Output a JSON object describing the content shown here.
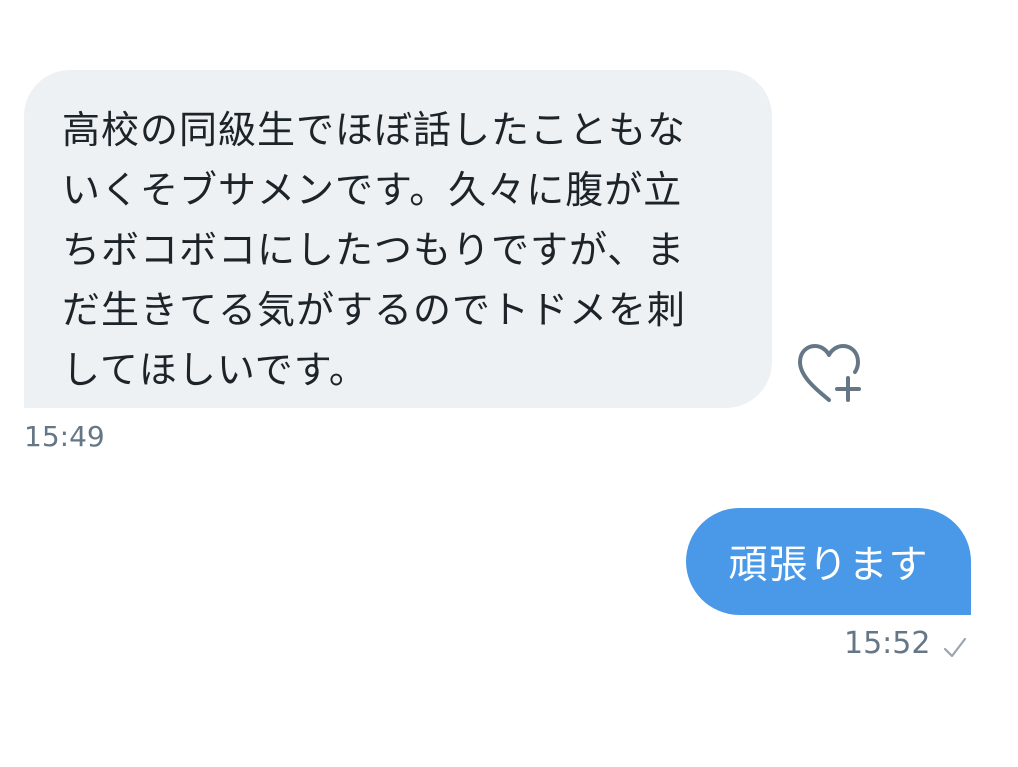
{
  "messages": [
    {
      "direction": "incoming",
      "text": "高校の同級生でほぼ話したこともな\nいくそブサメンです。久々に腹が立\nちボコボコにしたつもりですが、ま\nだ生きてる気がするのでトドメを刺\nしてほしいです。",
      "time": "15:49",
      "reaction_icon": "heart-plus-icon"
    },
    {
      "direction": "outgoing",
      "text": "頑張ります",
      "time": "15:52",
      "status_icon": "check-icon"
    }
  ],
  "colors": {
    "incoming_bubble": "#eef1f3",
    "outgoing_bubble": "#4a99e9",
    "timestamp": "#657786"
  }
}
